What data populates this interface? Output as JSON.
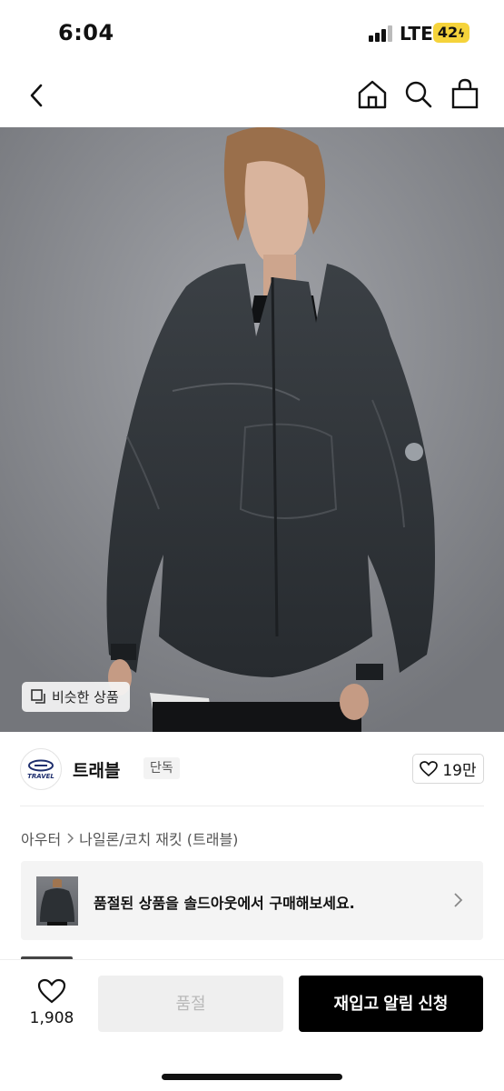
{
  "status_bar": {
    "time": "6:04",
    "network": "LTE",
    "battery": "42"
  },
  "nav": {
    "back_icon": "chevron-left-icon",
    "home_icon": "home-icon",
    "search_icon": "search-icon",
    "cart_icon": "shopping-bag-icon"
  },
  "hero": {
    "similar_label": "비슷한 상품"
  },
  "brand": {
    "logo_text": "TRAVEL",
    "name": "트래블",
    "badge": "단독",
    "likes": "19만"
  },
  "breadcrumb": {
    "category": "아우터",
    "subcategory": "나일론/코치 재킷 (트래블)"
  },
  "soldout_banner": {
    "text": "품절된 상품을 솔드아웃에서 구매해보세요."
  },
  "bottom_bar": {
    "wish_count": "1,908",
    "soldout_label": "품절",
    "restock_label": "재입고 알림 신청"
  },
  "colors": {
    "accent": "#000000",
    "battery": "#f5d33b",
    "disabled_bg": "#efefef",
    "disabled_text": "#b9b9b9"
  }
}
